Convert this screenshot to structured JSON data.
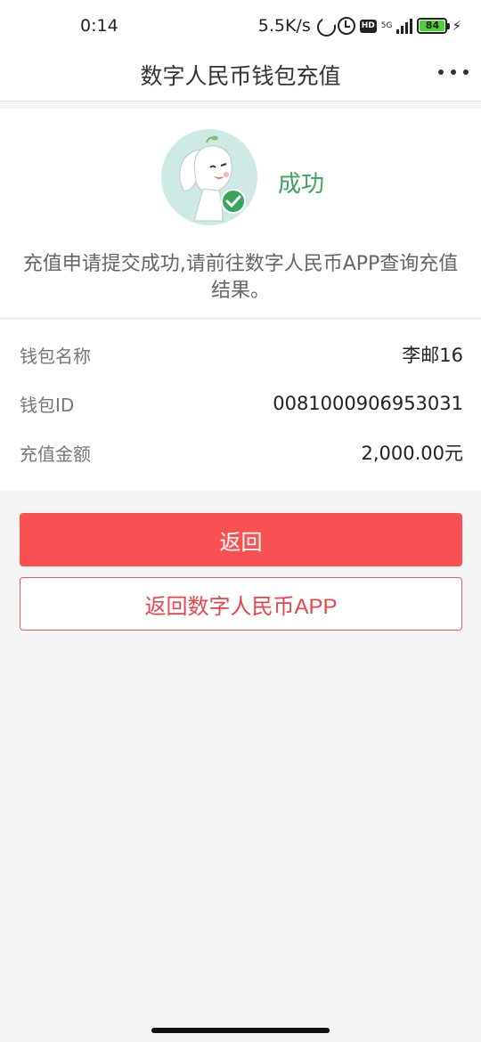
{
  "status_bar": {
    "time": "0:14",
    "net_speed": "5.5K/s",
    "hd_label": "HD",
    "network_type": "5G",
    "battery_level": "84",
    "battery_color": "#4cd137"
  },
  "nav": {
    "title": "数字人民币钱包充值",
    "more_icon": "more-horizontal-icon"
  },
  "result": {
    "mascot_icon": "elephant-mascot-success-icon",
    "status_text": "成功",
    "status_color": "#3aa55a",
    "message": "充值申请提交成功,请前往数字人民币APP查询充值结果。"
  },
  "details": [
    {
      "label": "钱包名称",
      "value": "李邮16"
    },
    {
      "label": "钱包ID",
      "value": "0081000906953031"
    },
    {
      "label": "充值金额",
      "value": "2,000.00元"
    }
  ],
  "actions": {
    "back_label": "返回",
    "back_to_app_label": "返回数字人民币APP",
    "primary_color": "#f95152"
  }
}
